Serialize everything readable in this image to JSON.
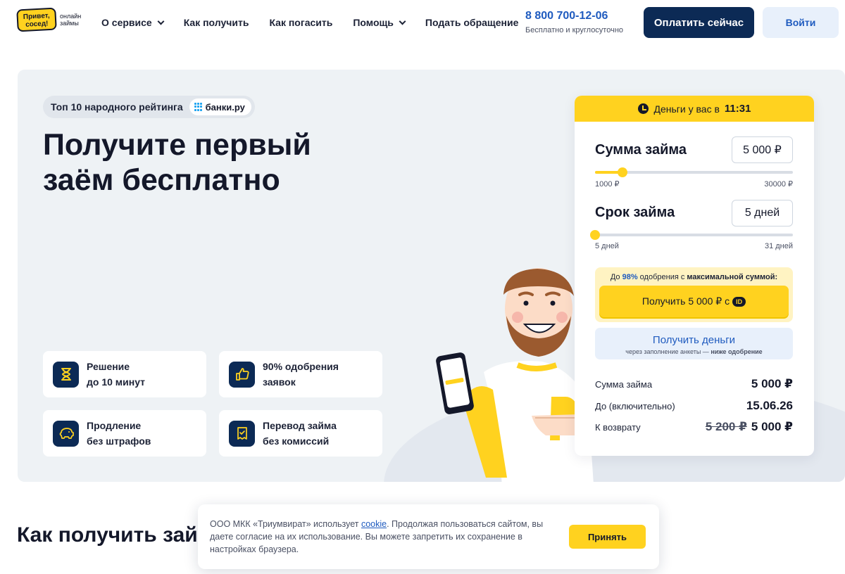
{
  "logo": {
    "brand": "Привет, сосед!",
    "tagline": "онлайн займы"
  },
  "nav": [
    {
      "label": "О сервисе",
      "dropdown": true
    },
    {
      "label": "Как получить",
      "dropdown": false
    },
    {
      "label": "Как погасить",
      "dropdown": false
    },
    {
      "label": "Помощь",
      "dropdown": true
    },
    {
      "label": "Подать обращение",
      "dropdown": false
    }
  ],
  "contact": {
    "phone": "8 800 700-12-06",
    "phone_note": "Бесплатно и круглосуточно"
  },
  "header_buttons": {
    "pay": "Оплатить сейчас",
    "login": "Войти"
  },
  "hero": {
    "rating_text": "Топ 10 народного рейтинга",
    "rating_partner": "банки.ру",
    "title_line1": "Получите первый",
    "title_line2": "заём бесплатно",
    "features": [
      {
        "icon": "hourglass-icon",
        "line1": "Решение",
        "line2": "до 10 минут"
      },
      {
        "icon": "thumbs-up-icon",
        "line1": "90% одобрения",
        "line2": "заявок"
      },
      {
        "icon": "piggy-bank-icon",
        "line1": "Продление",
        "line2": "без штрафов"
      },
      {
        "icon": "receipt-check-icon",
        "line1": "Перевод займа",
        "line2": "без комиссий"
      }
    ]
  },
  "calculator": {
    "timer_label": "Деньги у вас в",
    "timer_time": "11:31",
    "amount": {
      "label": "Сумма займа",
      "value": "5 000 ₽",
      "min": "1000 ₽",
      "max": "30000 ₽",
      "level": 0.14
    },
    "term": {
      "label": "Срок займа",
      "value": "5 дней",
      "min": "5 дней",
      "max": "31 дней",
      "level": 0.0
    },
    "promo": {
      "prefix": "До",
      "percent": "98%",
      "middle": "одобрения с",
      "bold": "максимальной суммой:",
      "button": "Получить 5 000 ₽ с",
      "badge": "ID"
    },
    "get_money": {
      "title": "Получить деньги",
      "sub_prefix": "через заполнение анкеты —",
      "sub_bold": "ниже одобрение"
    },
    "summary": [
      {
        "key": "Сумма займа",
        "value": "5 000 ₽"
      },
      {
        "key": "До (включительно)",
        "value": "15.06.26"
      },
      {
        "key": "К возврату",
        "old": "5 200 ₽",
        "value": "5 000 ₽"
      }
    ]
  },
  "section_title": "Как получить займ",
  "cookie": {
    "text_before": "ООО МКК «Триумвират» использует",
    "link": "cookie",
    "text_after": ". Продолжая пользоваться сайтом, вы даете согласие на их использование. Вы можете запретить их сохранение в настройках браузера.",
    "accept": "Принять"
  },
  "colors": {
    "accent_yellow": "#ffd21f",
    "navy": "#0c2a55",
    "link_blue": "#1f5bbf",
    "hero_bg": "#eef2f5"
  }
}
